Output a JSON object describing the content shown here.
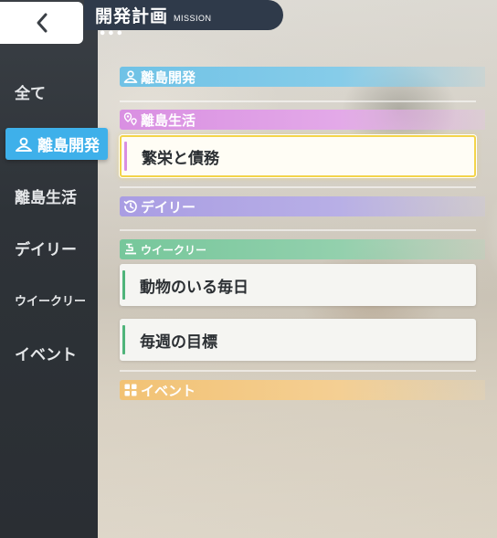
{
  "header": {
    "title": "開発計画",
    "subtitle": "MISSION",
    "dots": "•••"
  },
  "sidebar": {
    "items": [
      {
        "label": "全て"
      },
      {
        "label": "離島開発",
        "active": true,
        "icon": "person-pin-icon"
      },
      {
        "label": "離島生活"
      },
      {
        "label": "デイリー"
      },
      {
        "label": "ウイークリー"
      },
      {
        "label": "イベント"
      }
    ]
  },
  "sections": [
    {
      "label": "離島開発",
      "icon": "person-pin-icon",
      "color": "#6fc2e6"
    },
    {
      "label": "離島生活",
      "icon": "location-pins-icon",
      "color": "#d98fe2"
    },
    {
      "label": "デイリー",
      "icon": "history-icon",
      "color": "#a99de3"
    },
    {
      "label": "ウイークリー",
      "icon": "calendar-icon",
      "color": "#76c79b"
    },
    {
      "label": "イベント",
      "icon": "grid-icon",
      "color": "#f2c274"
    }
  ],
  "missions": [
    {
      "label": "繁栄と債務",
      "section": "離島生活",
      "accent": "#d98fe2",
      "selected": true
    },
    {
      "label": "動物のいる毎日",
      "section": "ウイークリー",
      "accent": "#4fb47a"
    },
    {
      "label": "毎週の目標",
      "section": "ウイークリー",
      "accent": "#4fb47a"
    }
  ],
  "colors": {
    "sidebar_active": "#3eb0ea",
    "selection_border": "#f3d44a"
  }
}
